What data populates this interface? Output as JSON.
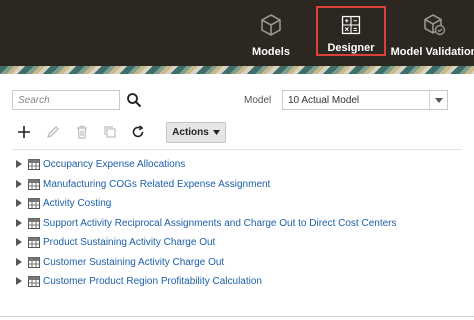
{
  "nav": {
    "items": [
      {
        "id": "models",
        "label": "Models",
        "icon": "cube-icon"
      },
      {
        "id": "designer",
        "label": "Designer",
        "icon": "calculator-icon",
        "selected": true
      },
      {
        "id": "validation",
        "label": "Model Validation",
        "icon": "cube-check-icon"
      }
    ]
  },
  "search": {
    "placeholder": "Search",
    "value": ""
  },
  "model": {
    "label": "Model",
    "selected": "10 Actual Model"
  },
  "toolbar": {
    "actions_label": "Actions"
  },
  "tree": {
    "rows": [
      "Occupancy Expense Allocations",
      "Manufacturing COGs Related Expense Assignment",
      "Activity Costing",
      "Support Activity Reciprocal Assignments and Charge Out to Direct Cost Centers",
      "Product Sustaining Activity Charge Out",
      "Customer Sustaining Activity Charge Out",
      "Customer Product Region Profitability Calculation"
    ]
  },
  "colors": {
    "topbar": "#2d2722",
    "highlight": "#d9413a",
    "link": "#1c5fa8"
  }
}
